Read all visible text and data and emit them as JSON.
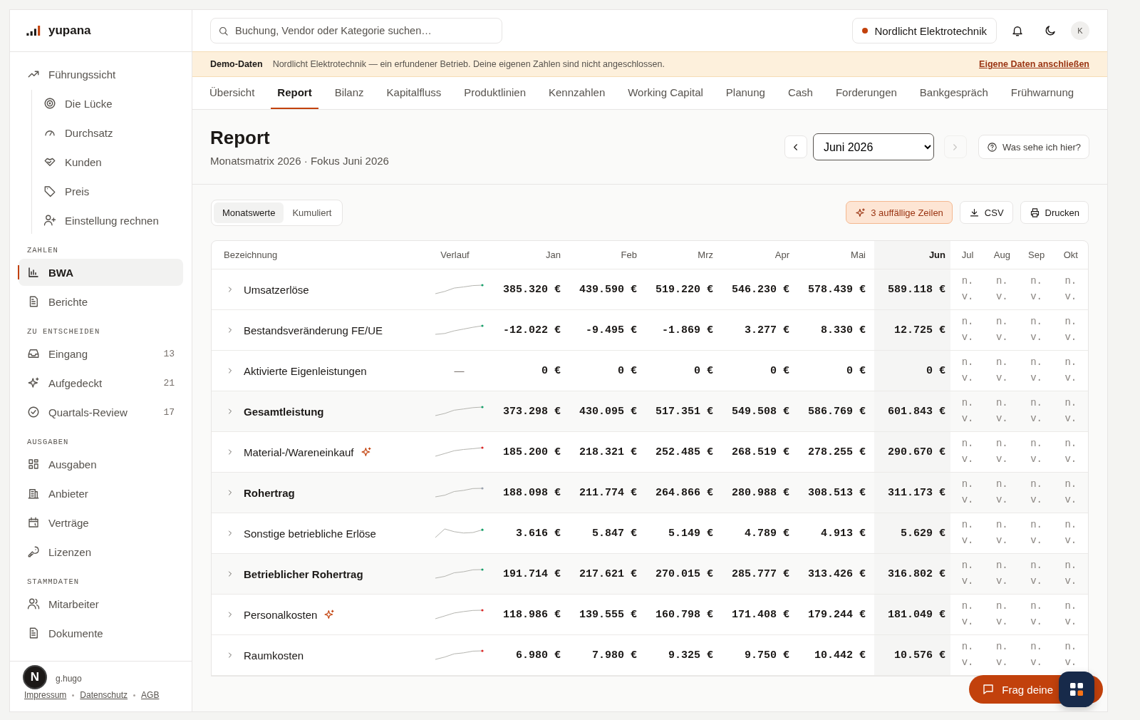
{
  "brand": "yupana",
  "sidebar": {
    "sections": [
      {
        "items": [
          {
            "label": "Führungssicht",
            "selected": false,
            "children": [
              {
                "label": "Die Lücke",
                "selected": false
              },
              {
                "label": "Durchsatz",
                "selected": false
              },
              {
                "label": "Kunden",
                "selected": false
              },
              {
                "label": "Preis",
                "selected": false
              },
              {
                "label": "Einstellung rechnen",
                "selected": false
              }
            ]
          }
        ]
      },
      {
        "heading": "ZAHLEN",
        "items": [
          {
            "label": "BWA",
            "selected": true
          },
          {
            "label": "Berichte",
            "selected": false
          }
        ]
      },
      {
        "heading": "ZU ENTSCHEIDEN",
        "items": [
          {
            "label": "Eingang",
            "selected": false,
            "count": "13"
          },
          {
            "label": "Aufgedeckt",
            "selected": false,
            "count": "21"
          },
          {
            "label": "Quartals-Review",
            "selected": false,
            "count": "17"
          }
        ]
      },
      {
        "heading": "AUSGABEN",
        "items": [
          {
            "label": "Ausgaben",
            "selected": false
          },
          {
            "label": "Anbieter",
            "selected": false
          },
          {
            "label": "Verträge",
            "selected": false
          },
          {
            "label": "Lizenzen",
            "selected": false
          }
        ]
      },
      {
        "heading": "STAMMDATEN",
        "items": [
          {
            "label": "Mitarbeiter",
            "selected": false
          },
          {
            "label": "Dokumente",
            "selected": false
          }
        ]
      }
    ],
    "footer": {
      "credit": "g.hugo",
      "links": [
        "Impressum",
        "Datenschutz",
        "AGB"
      ]
    }
  },
  "search": {
    "placeholder": "Buchung, Vendor oder Kategorie suchen…"
  },
  "company": {
    "name": "Nordlicht Elektrotechnik",
    "color": "#c2410c"
  },
  "avatar": "K",
  "banner": {
    "label": "Demo-Daten",
    "text": "Nordlicht Elektrotechnik — ein erfundener Betrieb. Deine eigenen Zahlen sind nicht angeschlossen.",
    "link": "Eigene Daten anschließen"
  },
  "tabs": [
    {
      "label": "Übersicht",
      "selected": false
    },
    {
      "label": "Report",
      "selected": true
    },
    {
      "label": "Bilanz",
      "selected": false
    },
    {
      "label": "Kapitalfluss",
      "selected": false
    },
    {
      "label": "Produktlinien",
      "selected": false
    },
    {
      "label": "Kennzahlen",
      "selected": false
    },
    {
      "label": "Working Capital",
      "selected": false
    },
    {
      "label": "Planung",
      "selected": false
    },
    {
      "label": "Cash",
      "selected": false
    },
    {
      "label": "Forderungen",
      "selected": false
    },
    {
      "label": "Bankgespräch",
      "selected": false
    },
    {
      "label": "Frühwarnung",
      "selected": false
    }
  ],
  "page": {
    "title": "Report",
    "subtitle": "Monatsmatrix 2026 · Fokus Juni 2026",
    "month": "Juni 2026",
    "next_disabled": true,
    "help": "Was sehe ich hier?"
  },
  "view_toggle": [
    {
      "label": "Monatswerte",
      "selected": true
    },
    {
      "label": "Kumuliert",
      "selected": false
    }
  ],
  "actions": [
    {
      "label": "3 auffällige Zeilen",
      "kind": "highlight"
    },
    {
      "label": "CSV",
      "kind": "download"
    },
    {
      "label": "Drucken",
      "kind": "print"
    }
  ],
  "table": {
    "columns": [
      {
        "label": "Bezeichnung",
        "selected": false
      },
      {
        "label": "Verlauf",
        "selected": false
      },
      {
        "label": "Jan",
        "selected": false
      },
      {
        "label": "Feb",
        "selected": false
      },
      {
        "label": "Mrz",
        "selected": false
      },
      {
        "label": "Apr",
        "selected": false
      },
      {
        "label": "Mai",
        "selected": false
      },
      {
        "label": "Jun",
        "selected": true
      },
      {
        "label": "Jul",
        "selected": false
      },
      {
        "label": "Aug",
        "selected": false
      },
      {
        "label": "Sep",
        "selected": false
      },
      {
        "label": "Okt",
        "selected": false
      }
    ],
    "rows": [
      {
        "label": "Umsatzerlöse",
        "kind": "line",
        "flagged": false,
        "color": "#16a06a",
        "values": [
          "385.320 €",
          "439.590 €",
          "519.220 €",
          "546.230 €",
          "578.439 €",
          "589.118 €",
          "n. v.",
          "n. v.",
          "n. v.",
          "n. v."
        ]
      },
      {
        "label": "Bestandsveränderung FE/UE",
        "kind": "line",
        "flagged": false,
        "color": "#16a06a",
        "values": [
          "-12.022 €",
          "-9.495 €",
          "-1.869 €",
          "3.277 €",
          "8.330 €",
          "12.725 €",
          "n. v.",
          "n. v.",
          "n. v.",
          "n. v."
        ]
      },
      {
        "label": "Aktivierte Eigenleistungen",
        "kind": "line",
        "flagged": false,
        "trend_text": "—",
        "values": [
          "0 €",
          "0 €",
          "0 €",
          "0 €",
          "0 €",
          "0 €",
          "n. v.",
          "n. v.",
          "n. v.",
          "n. v."
        ]
      },
      {
        "label": "Gesamtleistung",
        "kind": "total",
        "flagged": false,
        "color": "#16a06a",
        "values": [
          "373.298 €",
          "430.095 €",
          "517.351 €",
          "549.508 €",
          "586.769 €",
          "601.843 €",
          "n. v.",
          "n. v.",
          "n. v.",
          "n. v."
        ]
      },
      {
        "label": "Material-/Wareneinkauf",
        "kind": "line",
        "flagged": true,
        "color": "#dc2626",
        "values": [
          "185.200 €",
          "218.321 €",
          "252.485 €",
          "268.519 €",
          "278.255 €",
          "290.670 €",
          "n. v.",
          "n. v.",
          "n. v.",
          "n. v."
        ]
      },
      {
        "label": "Rohertrag",
        "kind": "total",
        "flagged": false,
        "color": "#9ca3af",
        "values": [
          "188.098 €",
          "211.774 €",
          "264.866 €",
          "280.988 €",
          "308.513 €",
          "311.173 €",
          "n. v.",
          "n. v.",
          "n. v.",
          "n. v."
        ]
      },
      {
        "label": "Sonstige betriebliche Erlöse",
        "kind": "line",
        "flagged": false,
        "color": "#16a06a",
        "values": [
          "3.616 €",
          "5.847 €",
          "5.149 €",
          "4.789 €",
          "4.913 €",
          "5.629 €",
          "n. v.",
          "n. v.",
          "n. v.",
          "n. v."
        ]
      },
      {
        "label": "Betrieblicher Rohertrag",
        "kind": "total",
        "flagged": false,
        "color": "#16a06a",
        "values": [
          "191.714 €",
          "217.621 €",
          "270.015 €",
          "285.777 €",
          "313.426 €",
          "316.802 €",
          "n. v.",
          "n. v.",
          "n. v.",
          "n. v."
        ]
      },
      {
        "label": "Personalkosten",
        "kind": "line",
        "flagged": true,
        "color": "#dc2626",
        "values": [
          "118.986 €",
          "139.555 €",
          "160.798 €",
          "171.408 €",
          "179.244 €",
          "181.049 €",
          "n. v.",
          "n. v.",
          "n. v.",
          "n. v."
        ]
      },
      {
        "label": "Raumkosten",
        "kind": "line",
        "flagged": false,
        "color": "#dc2626",
        "values": [
          "6.980 €",
          "7.980 €",
          "9.325 €",
          "9.750 €",
          "10.442 €",
          "10.576 €",
          "n. v.",
          "n. v.",
          "n. v.",
          "n. v."
        ]
      }
    ]
  },
  "chat_button": "Frag deine",
  "dev_badge": "N"
}
